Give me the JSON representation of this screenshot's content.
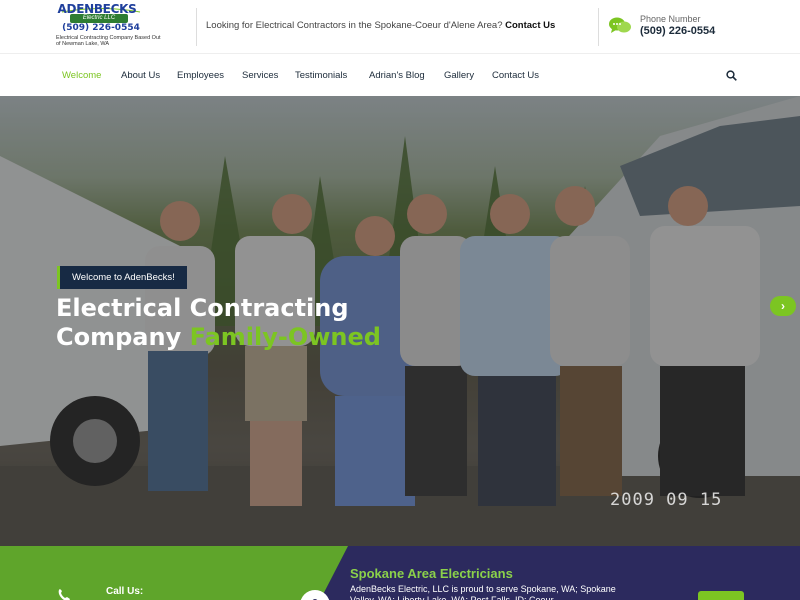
{
  "header": {
    "logo": {
      "name": "ADENBECKS",
      "script": "Electric LLC",
      "phone": "(509) 226-0554",
      "tagline": "Electrical Contracting Company Based Out of Newman Lake, WA"
    },
    "contact_question": "Looking for Electrical Contractors in the Spokane-Coeur d'Alene Area?",
    "contact_link": "Contact Us",
    "phone_label": "Phone Number",
    "phone_number": "(509) 226-0554",
    "icons": {
      "chat": "chat-bubbles-icon",
      "search": "search-icon"
    }
  },
  "nav": {
    "items": [
      {
        "label": "Welcome",
        "active": true
      },
      {
        "label": "About Us"
      },
      {
        "label": "Employees"
      },
      {
        "label": "Services"
      },
      {
        "label": "Testimonials"
      },
      {
        "label": "Adrian's Blog"
      },
      {
        "label": "Gallery"
      },
      {
        "label": "Contact Us"
      }
    ]
  },
  "hero": {
    "badge": "Welcome to AdenBecks!",
    "title_line1": "Electrical Contracting",
    "title_line2_prefix": "Company ",
    "title_line2_highlight": "Family-Owned",
    "date_stamp": "2009 09 15",
    "next_arrow": "›"
  },
  "bottom": {
    "call_label": "Call Us:",
    "title": "Spokane Area Electricians",
    "text": "AdenBecks Electric, LLC is proud to serve Spokane, WA; Spokane Valley, WA; Liberty Lake, WA; Post Falls, ID; Coeur"
  },
  "colors": {
    "accent_green": "#7cc522",
    "navy": "#172a44",
    "bottom_navy": "#2c2a5e",
    "bottom_green": "#5fa52b"
  }
}
